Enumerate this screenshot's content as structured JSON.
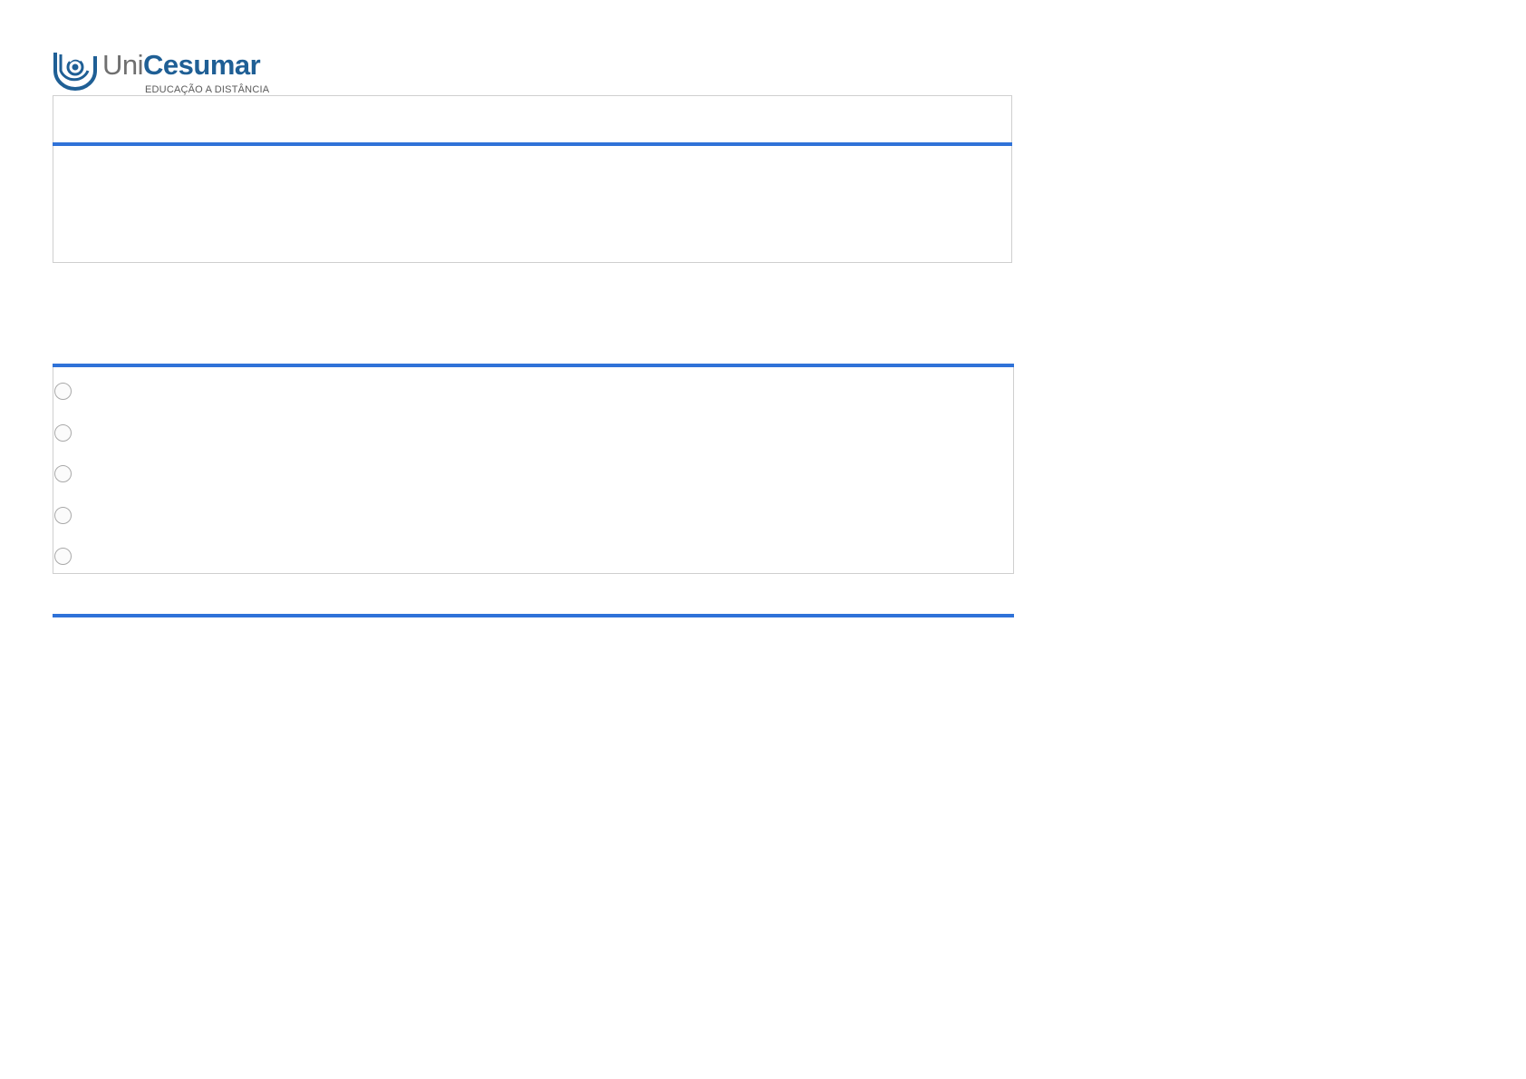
{
  "logo": {
    "wordmark_part1": "Uni",
    "wordmark_part2": "Cesumar",
    "tagline": "EDUCAÇÃO A DISTÂNCIA",
    "colors": {
      "primary": "#1f5f95",
      "secondary": "#6f6f6f"
    }
  },
  "question": {
    "title": "",
    "text": ""
  },
  "options": [
    {
      "label": ""
    },
    {
      "label": ""
    },
    {
      "label": ""
    },
    {
      "label": ""
    },
    {
      "label": ""
    }
  ],
  "colors": {
    "accent": "#2f72d8",
    "border": "#cfcfcf",
    "radio_border": "#a9a9a9"
  }
}
